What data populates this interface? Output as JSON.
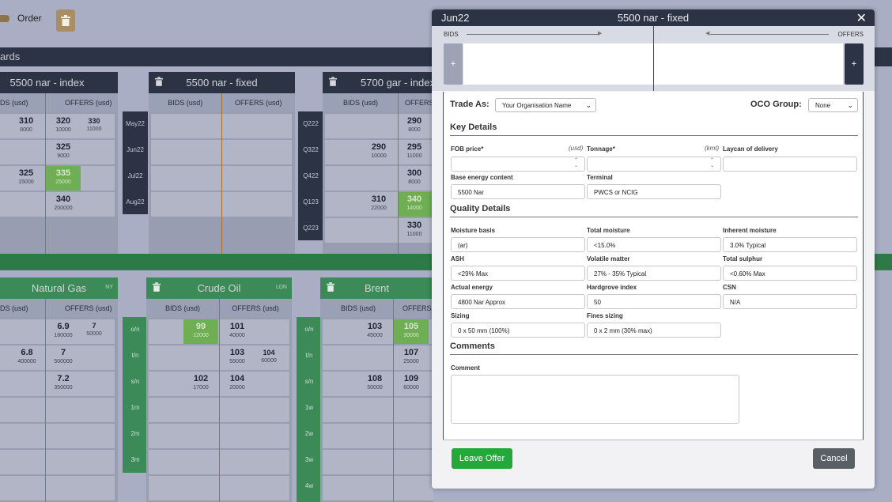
{
  "toolbar": {
    "order_label": "Order"
  },
  "section_title": "ards",
  "colors": {
    "navy": "#2b3344",
    "green": "#3b8a58",
    "highlight": "#6fae52",
    "accent_line": "#a66f34",
    "leave_btn": "#23a83a",
    "cancel_btn": "#5a5f66"
  },
  "boards": {
    "nar_index": {
      "title": "5500 nar - index",
      "bids_header": "DS (usd)",
      "offers_header": "OFFERS (usd)",
      "rows": [
        {
          "bid": "310",
          "bid_qty": "8000",
          "offer": "320",
          "offer_qty": "10000",
          "offer2": "330",
          "offer2_qty": "11000"
        },
        {
          "bid": "",
          "bid_qty": "",
          "offer": "325",
          "offer_qty": "9000",
          "offer2": "",
          "offer2_qty": ""
        },
        {
          "bid": "325",
          "bid_qty": "15000",
          "offer": "335",
          "offer_qty": "25000",
          "offer2": "",
          "offer2_qty": ""
        },
        {
          "bid": "",
          "bid_qty": "",
          "offer": "340",
          "offer_qty": "200000",
          "offer2": "",
          "offer2_qty": ""
        }
      ]
    },
    "nar_fixed": {
      "title": "5500 nar - fixed",
      "bids_header": "BIDS (usd)",
      "offers_header": "OFFERS (usd)",
      "periods": [
        "May22",
        "Jun22",
        "Jul22",
        "Aug22"
      ]
    },
    "gar_index": {
      "title": "5700 gar - index",
      "bids_header": "BIDS (usd)",
      "offers_header": "OFFERS",
      "periods": [
        "Q222",
        "Q322",
        "Q422",
        "Q123",
        "Q223"
      ],
      "rows": [
        {
          "bid": "",
          "bid_qty": "",
          "offer": "290",
          "offer_qty": "8000"
        },
        {
          "bid": "290",
          "bid_qty": "10000",
          "offer": "295",
          "offer_qty": "11000"
        },
        {
          "bid": "",
          "bid_qty": "",
          "offer": "300",
          "offer_qty": "8000"
        },
        {
          "bid": "310",
          "bid_qty": "22000",
          "offer": "340",
          "offer_qty": "14000"
        },
        {
          "bid": "",
          "bid_qty": "",
          "offer": "330",
          "offer_qty": "11000"
        }
      ]
    },
    "natural_gas": {
      "title": "Natural Gas",
      "tag": "NY",
      "bids_header": "DS (usd)",
      "offers_header": "OFFERS (usd)",
      "rows": [
        {
          "bid": "",
          "bid_qty": "",
          "offer": "6.9",
          "offer_qty": "180000",
          "offer2": "7",
          "offer2_qty": "50000"
        },
        {
          "bid": "6.8",
          "bid_qty": "400000",
          "offer": "7",
          "offer_qty": "500000",
          "offer2": "",
          "offer2_qty": ""
        },
        {
          "bid": "",
          "bid_qty": "",
          "offer": "7.2",
          "offer_qty": "350000",
          "offer2": "",
          "offer2_qty": ""
        }
      ]
    },
    "crude_oil": {
      "title": "Crude Oil",
      "tag": "LDN",
      "bids_header": "BIDS (usd)",
      "offers_header": "OFFERS (usd)",
      "periods": [
        "o/n",
        "t/n",
        "s/n",
        "1m",
        "2m",
        "3m"
      ],
      "rows": [
        {
          "bid": "99",
          "bid_qty": "12000",
          "offer": "101",
          "offer_qty": "40000",
          "offer2": "",
          "offer2_qty": ""
        },
        {
          "bid": "",
          "bid_qty": "",
          "offer": "103",
          "offer_qty": "55000",
          "offer2": "104",
          "offer2_qty": "60000"
        },
        {
          "bid": "102",
          "bid_qty": "17000",
          "offer": "104",
          "offer_qty": "20000",
          "offer2": "",
          "offer2_qty": ""
        }
      ]
    },
    "brent": {
      "title": "Brent",
      "bids_header": "BIDS (usd)",
      "offers_header": "OFFERS",
      "periods": [
        "o/n",
        "t/n",
        "s/n",
        "1w",
        "2w",
        "3w",
        "4w"
      ],
      "rows": [
        {
          "bid": "103",
          "bid_qty": "45000",
          "offer": "105",
          "offer_qty": "30000"
        },
        {
          "bid": "",
          "bid_qty": "",
          "offer": "107",
          "offer_qty": "25000"
        },
        {
          "bid": "108",
          "bid_qty": "50000",
          "offer": "109",
          "offer_qty": "60000"
        }
      ]
    }
  },
  "modal": {
    "period": "Jun22",
    "title": "5500 nar - fixed",
    "close_glyph": "✕",
    "ladder": {
      "bids_label": "BIDS",
      "offers_label": "OFFERS",
      "add_glyph": "+"
    },
    "trade_as": {
      "label": "Trade As:",
      "value": "Your Organisation Name"
    },
    "oco_group": {
      "label": "OCO Group:",
      "value": "None"
    },
    "key_details": {
      "heading": "Key Details",
      "fob_price": {
        "label": "FOB price*",
        "unit": "(usd)",
        "value": ""
      },
      "tonnage": {
        "label": "Tonnage*",
        "unit": "(kmt)",
        "value": ""
      },
      "laycan": {
        "label": "Laycan of delivery",
        "value": ""
      },
      "base_energy": {
        "label": "Base energy content",
        "value": "5500 Nar"
      },
      "terminal": {
        "label": "Terminal",
        "value": "PWCS or NCIG"
      }
    },
    "quality_details": {
      "heading": "Quality Details",
      "moisture_basis": {
        "label": "Moisture basis",
        "value": "(ar)"
      },
      "total_moisture": {
        "label": "Total moisture",
        "value": "<15.0%"
      },
      "inherent_moisture": {
        "label": "Inherent moisture",
        "value": "3.0% Typical"
      },
      "ash": {
        "label": "ASH",
        "value": "<29% Max"
      },
      "volatile_matter": {
        "label": "Volatile matter",
        "value": "27% - 35% Typical"
      },
      "total_sulphur": {
        "label": "Total sulphur",
        "value": "<0.60% Max"
      },
      "actual_energy": {
        "label": "Actual energy",
        "value": "4800 Nar Approx"
      },
      "hardgrove": {
        "label": "Hardgrove index",
        "value": "50"
      },
      "csn": {
        "label": "CSN",
        "value": "N/A"
      },
      "sizing": {
        "label": "Sizing",
        "value": "0 x 50 mm (100%)"
      },
      "fines_sizing": {
        "label": "Fines sizing",
        "value": "0 x 2 mm (30% max)"
      }
    },
    "comments": {
      "heading": "Comments",
      "label": "Comment",
      "value": ""
    },
    "leave_offer_label": "Leave Offer",
    "cancel_label": "Cancel"
  }
}
